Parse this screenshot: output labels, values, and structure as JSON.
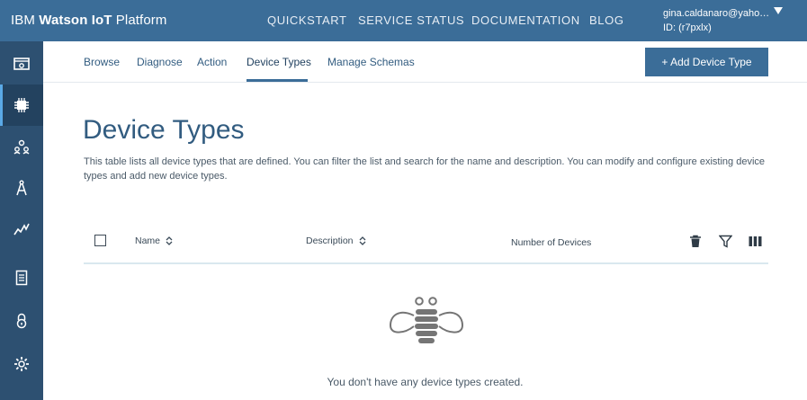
{
  "header": {
    "brand_prefix": "IBM ",
    "brand_bold": "Watson IoT",
    "brand_suffix": " Platform",
    "nav": [
      "QUICKSTART",
      "SERVICE STATUS",
      "DOCUMENTATION",
      "BLOG"
    ],
    "user_email": "gina.caldanaro@yaho…",
    "user_id": "ID: (r7pxlx)"
  },
  "sidebar": {
    "items": [
      {
        "icon": "dashboard-icon",
        "active": false
      },
      {
        "icon": "chip-icon",
        "active": true
      },
      {
        "icon": "members-icon",
        "active": false
      },
      {
        "icon": "compass-icon",
        "active": false
      },
      {
        "icon": "usage-chart-icon",
        "active": false
      },
      {
        "icon": "document-icon",
        "active": false
      },
      {
        "icon": "lock-icon",
        "active": false
      },
      {
        "icon": "settings-icon",
        "active": false
      }
    ]
  },
  "subnav": {
    "tabs": [
      "Browse",
      "Diagnose",
      "Action",
      "Device Types",
      "Manage Schemas"
    ],
    "active": "Device Types",
    "add_button": "+ Add Device Type"
  },
  "main": {
    "title": "Device Types",
    "description": "This table lists all device types that are defined. You can filter the list and search for the name and description. You can modify and configure existing device types and add new device types."
  },
  "table": {
    "columns": [
      "Name",
      "Description",
      "Number of Devices"
    ],
    "tools": [
      "delete-icon",
      "filter-icon",
      "columns-icon"
    ],
    "empty_message": "You don't have any device types created."
  },
  "colors": {
    "topbar": "#3b6d98",
    "sidebar": "#2d5071",
    "accent": "#3b6d98"
  }
}
